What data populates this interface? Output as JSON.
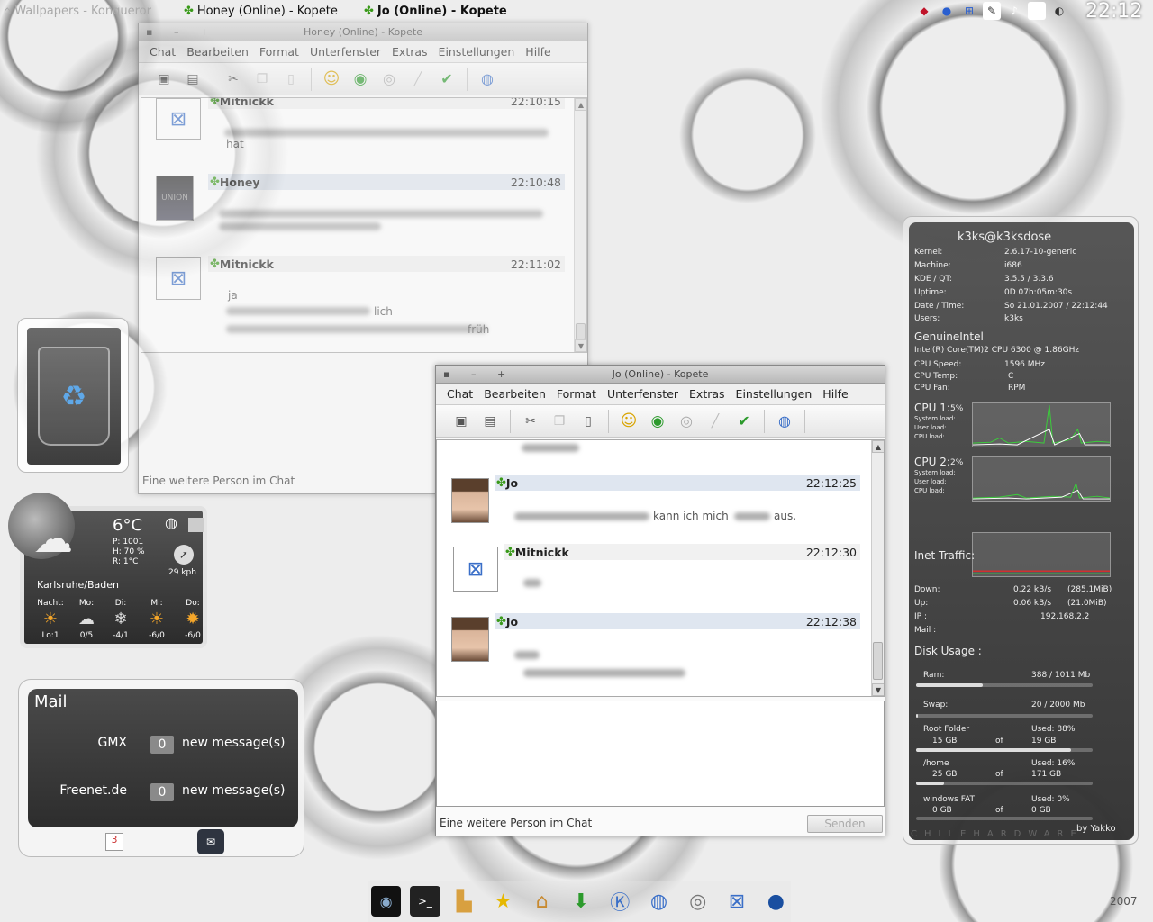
{
  "taskbar": {
    "tasks": [
      "Wallpapers - Konqueror",
      "Honey (Online) - Kopete",
      "Jo (Online) - Kopete"
    ],
    "clock": "22:12"
  },
  "back_window": {
    "title": "Honey (Online) - Kopete",
    "menu": [
      "Chat",
      "Bearbeiten",
      "Format",
      "Unterfenster",
      "Extras",
      "Einstellungen",
      "Hilfe"
    ],
    "messages": [
      {
        "sender": "Mitnickk",
        "time": "22:10:15",
        "text": "hat"
      },
      {
        "sender": "Honey",
        "time": "22:10:48",
        "text": ""
      },
      {
        "sender": "Mitnickk",
        "time": "22:11:02",
        "lines": [
          "ja",
          "lich",
          "früh"
        ]
      }
    ],
    "status": "Eine weitere Person im Chat"
  },
  "front_window": {
    "title": "Jo (Online) - Kopete",
    "menu": [
      "Chat",
      "Bearbeiten",
      "Format",
      "Unterfenster",
      "Extras",
      "Einstellungen",
      "Hilfe"
    ],
    "messages": [
      {
        "sender": "Jo",
        "time": "22:12:25",
        "text": "kann ich mich",
        "text2": "aus."
      },
      {
        "sender": "Mitnickk",
        "time": "22:12:30"
      },
      {
        "sender": "Jo",
        "time": "22:12:38"
      }
    ],
    "status": "Eine weitere Person im Chat",
    "send_label": "Senden"
  },
  "weather": {
    "temp": "6°C",
    "pressure": "P:  1001",
    "humidity": "H:  70 %",
    "realfeel": "R:  1°C",
    "wind": "29 kph",
    "location": "Karlsruhe/Baden",
    "days": [
      {
        "name": "Nacht:",
        "temp": "Lo:1"
      },
      {
        "name": "Mo:",
        "temp": "0/5"
      },
      {
        "name": "Di:",
        "temp": "-4/1"
      },
      {
        "name": "Mi:",
        "temp": "-6/0"
      },
      {
        "name": "Do:",
        "temp": "-6/0"
      }
    ]
  },
  "mail": {
    "title": "Mail",
    "accounts": [
      {
        "name": "GMX",
        "count": "0",
        "label": "new message(s)"
      },
      {
        "name": "Freenet.de",
        "count": "0",
        "label": "new message(s)"
      }
    ]
  },
  "sysmon": {
    "host": "k3ks@k3ksdose",
    "rows": [
      {
        "k": "Kernel:",
        "v": "2.6.17-10-generic"
      },
      {
        "k": "Machine:",
        "v": "i686"
      },
      {
        "k": "KDE / QT:",
        "v": "3.5.5              / 3.3.6"
      },
      {
        "k": "Uptime:",
        "v": "0D   07h:05m:30s"
      },
      {
        "k": "Date / Time:",
        "v": "So 21.01.2007  /  22:12:44"
      },
      {
        "k": "Users:",
        "v": "k3ks"
      }
    ],
    "cpu_vendor": "GenuineIntel",
    "cpu_model": "Intel(R) Core(TM)2 CPU          6300  @ 1.86GHz",
    "cpu_rows": [
      {
        "k": "CPU Speed:",
        "v": "1596 MHz"
      },
      {
        "k": "CPU Temp:",
        "v": "C"
      },
      {
        "k": "CPU Fan:",
        "v": "RPM"
      }
    ],
    "cpu1": "CPU 1:",
    "cpu1_pct": "5%",
    "cpu2": "CPU 2:",
    "cpu2_pct": "2%",
    "loads": [
      "System load:",
      "User load:",
      "CPU load:"
    ],
    "traffic": "Inet Traffic:",
    "net": [
      {
        "k": "Down:",
        "v": "0.22 kB/s",
        "t": "(285.1MiB)"
      },
      {
        "k": "Up:",
        "v": "0.06 kB/s",
        "t": "(21.0MiB)"
      }
    ],
    "ip_label": "IP :",
    "ip": "192.168.2.2",
    "mail_label": "Mail :",
    "disk_title": "Disk Usage :",
    "ram_label": "Ram:",
    "ram": "388 / 1011 Mb",
    "ram_frac": 0.38,
    "swap_label": "Swap:",
    "swap": "20 / 2000 Mb",
    "swap_frac": 0.01,
    "disks": [
      {
        "name": "Root Folder",
        "used": "Used: 88%",
        "size": "15 GB",
        "of": "of",
        "total": "19 GB",
        "frac": 0.88
      },
      {
        "name": "/home",
        "used": "Used: 16%",
        "size": "25 GB",
        "of": "of",
        "total": "171 GB",
        "frac": 0.16
      },
      {
        "name": "windows FAT",
        "used": "Used: 0%",
        "size": "0 GB",
        "of": "of",
        "total": "0 GB",
        "frac": 0.0
      }
    ],
    "credit": "by Yakko",
    "footer": "CHILEHARDWARE"
  },
  "signature_year": "2007"
}
